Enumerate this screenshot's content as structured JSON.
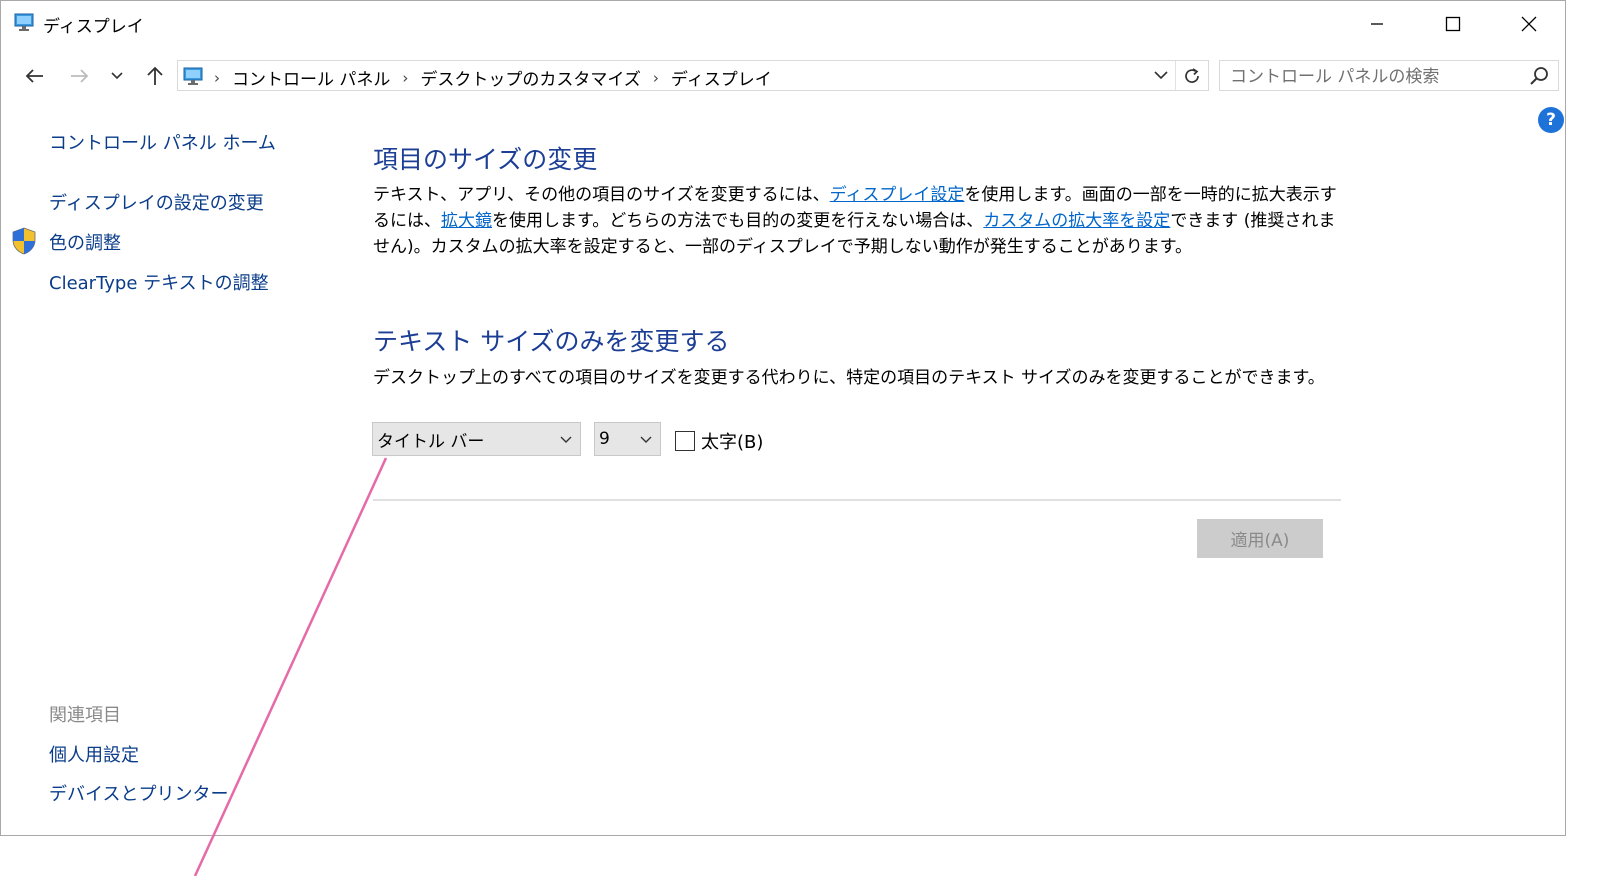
{
  "window": {
    "title": "ディスプレイ"
  },
  "address": {
    "breadcrumbs": [
      "コントロール パネル",
      "デスクトップのカスタマイズ",
      "ディスプレイ"
    ],
    "search_placeholder": "コントロール パネルの検索"
  },
  "help": {
    "label": "?"
  },
  "sidebar": {
    "items": [
      {
        "label": "コントロール パネル ホーム"
      },
      {
        "label": "ディスプレイの設定の変更"
      },
      {
        "label": "色の調整"
      },
      {
        "label": "ClearType テキストの調整"
      }
    ],
    "related_heading": "関連項目",
    "related_items": [
      {
        "label": "個人用設定"
      },
      {
        "label": "デバイスとプリンター"
      }
    ]
  },
  "main": {
    "section1": {
      "heading": "項目のサイズの変更",
      "text_1": "テキスト、アプリ、その他の項目のサイズを変更するには、",
      "link_display_settings": "ディスプレイ設定",
      "text_2": "を使用します。画面の一部を一時的に拡大表示するには、",
      "link_magnifier": "拡大鏡",
      "text_3": "を使用します。どちらの方法でも目的の変更を行えない場合は、",
      "link_custom_scaling": "カスタムの拡大率を設定",
      "text_4": "できます (推奨されません)。カスタムの拡大率を設定すると、一部のディスプレイで予期しない動作が発生することがあります。"
    },
    "section2": {
      "heading": "テキスト サイズのみを変更する",
      "description": "デスクトップ上のすべての項目のサイズを変更する代わりに、特定の項目のテキスト サイズのみを変更することができます。",
      "item_select_value": "タイトル バー",
      "size_select_value": "9",
      "bold_label": "太字(B)",
      "bold_checked": false
    },
    "apply_label": "適用(A)"
  },
  "colors": {
    "heading": "#1c3e95",
    "link": "#0066cc",
    "nav_link": "#0a3c8a",
    "callout_line": "#e66aa8"
  }
}
